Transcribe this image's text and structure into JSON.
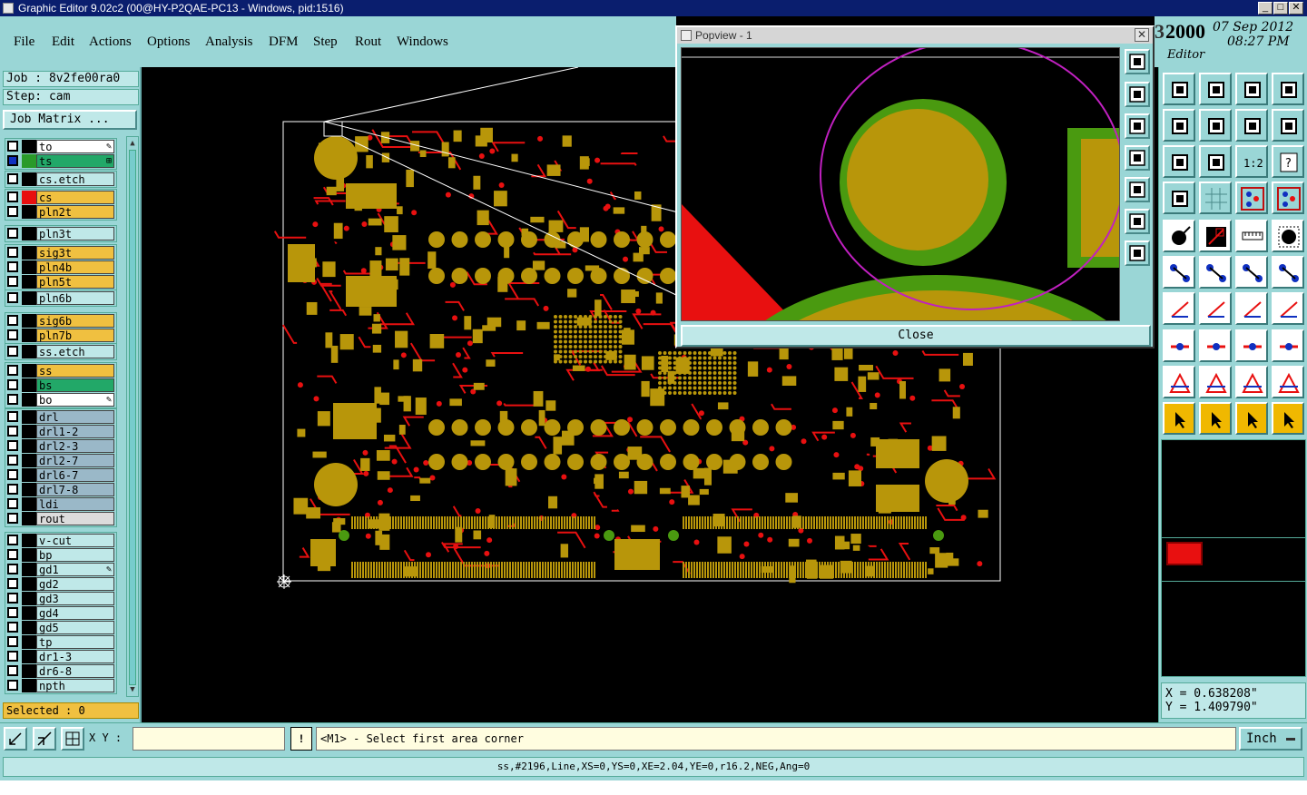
{
  "window": {
    "title": "Graphic Editor 9.02c2 (00@HY-P2QAE-PC13 - Windows, pid:1516)"
  },
  "menu": [
    "File",
    "Edit",
    "Actions",
    "Options",
    "Analysis",
    "DFM",
    "Step",
    "Rout",
    "Windows"
  ],
  "header_info": {
    "year_prefix": "3",
    "year": "2000",
    "date": "07 Sep 2012",
    "time": "08:27 PM",
    "mode": "Editor"
  },
  "job": {
    "job_line": "Job : 8v2fe00ra0",
    "step_line": "Step: cam",
    "matrix_button": "Job Matrix ..."
  },
  "layers": [
    {
      "name": "to",
      "color": "#ffffff",
      "swatch": "#000000",
      "mark": "✎"
    },
    {
      "name": "ts",
      "color": "#22a868",
      "swatch": "#2a9a2a",
      "mark": "⊞"
    },
    {
      "name": "cs.etch",
      "color": "#bfe8e8",
      "swatch": "#000000",
      "mark": ""
    },
    {
      "name": "cs",
      "color": "#f0c040",
      "swatch": "#e81010",
      "mark": ""
    },
    {
      "name": "pln2t",
      "color": "#f0c040",
      "swatch": "#000000",
      "mark": ""
    },
    {
      "name": "pln3t",
      "color": "#bfe8e8",
      "swatch": "#000000",
      "mark": ""
    },
    {
      "name": "sig3t",
      "color": "#f0c040",
      "swatch": "#000000",
      "mark": ""
    },
    {
      "name": "pln4b",
      "color": "#f0c040",
      "swatch": "#000000",
      "mark": ""
    },
    {
      "name": "pln5t",
      "color": "#f0c040",
      "swatch": "#000000",
      "mark": ""
    },
    {
      "name": "pln6b",
      "color": "#bfe8e8",
      "swatch": "#000000",
      "mark": ""
    },
    {
      "name": "sig6b",
      "color": "#f0c040",
      "swatch": "#000000",
      "mark": ""
    },
    {
      "name": "pln7b",
      "color": "#f0c040",
      "swatch": "#000000",
      "mark": ""
    },
    {
      "name": "ss.etch",
      "color": "#bfe8e8",
      "swatch": "#000000",
      "mark": ""
    },
    {
      "name": "ss",
      "color": "#f0c040",
      "swatch": "#000000",
      "mark": ""
    },
    {
      "name": "bs",
      "color": "#22a868",
      "swatch": "#000000",
      "mark": ""
    },
    {
      "name": "bo",
      "color": "#ffffff",
      "swatch": "#000000",
      "mark": "✎"
    },
    {
      "name": "drl",
      "color": "#9ab8c8",
      "swatch": "#000000",
      "mark": ""
    },
    {
      "name": "drl1-2",
      "color": "#9ab8c8",
      "swatch": "#000000",
      "mark": ""
    },
    {
      "name": "drl2-3",
      "color": "#9ab8c8",
      "swatch": "#000000",
      "mark": ""
    },
    {
      "name": "drl2-7",
      "color": "#9ab8c8",
      "swatch": "#000000",
      "mark": ""
    },
    {
      "name": "drl6-7",
      "color": "#9ab8c8",
      "swatch": "#000000",
      "mark": ""
    },
    {
      "name": "drl7-8",
      "color": "#9ab8c8",
      "swatch": "#000000",
      "mark": ""
    },
    {
      "name": "ldi",
      "color": "#9ab8c8",
      "swatch": "#000000",
      "mark": ""
    },
    {
      "name": "rout",
      "color": "#dcdcdc",
      "swatch": "#000000",
      "mark": ""
    },
    {
      "name": "v-cut",
      "color": "#bfe8e8",
      "swatch": "#000000",
      "mark": ""
    },
    {
      "name": "bp",
      "color": "#bfe8e8",
      "swatch": "#000000",
      "mark": ""
    },
    {
      "name": "gd1",
      "color": "#bfe8e8",
      "swatch": "#000000",
      "mark": "✎"
    },
    {
      "name": "gd2",
      "color": "#bfe8e8",
      "swatch": "#000000",
      "mark": ""
    },
    {
      "name": "gd3",
      "color": "#bfe8e8",
      "swatch": "#000000",
      "mark": ""
    },
    {
      "name": "gd4",
      "color": "#bfe8e8",
      "swatch": "#000000",
      "mark": ""
    },
    {
      "name": "gd5",
      "color": "#bfe8e8",
      "swatch": "#000000",
      "mark": ""
    },
    {
      "name": "tp",
      "color": "#bfe8e8",
      "swatch": "#000000",
      "mark": ""
    },
    {
      "name": "dr1-3",
      "color": "#bfe8e8",
      "swatch": "#000000",
      "mark": ""
    },
    {
      "name": "dr6-8",
      "color": "#bfe8e8",
      "swatch": "#000000",
      "mark": ""
    },
    {
      "name": "npth",
      "color": "#bfe8e8",
      "swatch": "#000000",
      "mark": ""
    }
  ],
  "selected_text": "Selected : 0",
  "popview": {
    "title": "Popview - 1",
    "close_x": "✕",
    "close_button": "Close"
  },
  "coords": {
    "x": "X = 0.638208\"",
    "y": "Y = 1.409790\""
  },
  "bottom": {
    "xy_label": "X Y :",
    "xy_value": "",
    "warn": "!",
    "prompt": "<M1> - Select first area corner",
    "units": "Inch"
  },
  "status": "ss,#2196,Line,XS=0,YS=0,XE=2.04,YE=0,r16.2,NEG,Ang=0",
  "colors": {
    "panel": "#9ad6d6",
    "copper": "#b8960a",
    "trace": "#e81010",
    "solder_mask": "#4a9a10",
    "highlight_circle": "#c020c0"
  }
}
